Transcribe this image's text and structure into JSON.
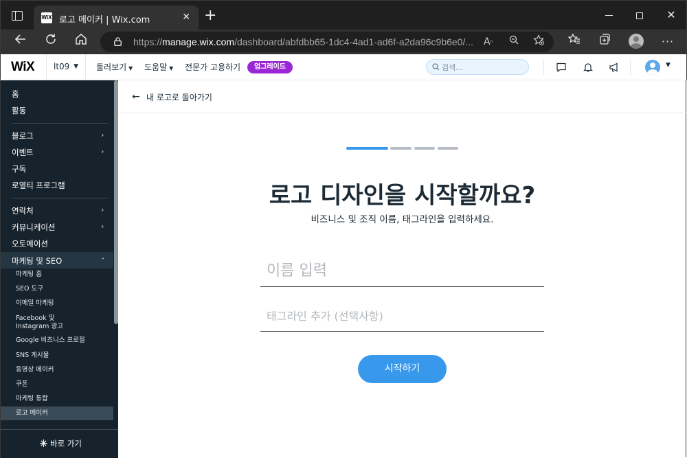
{
  "browser": {
    "tab_title": "로고 메이커 | Wix.com",
    "tab_favicon_text": "WiX",
    "url_prefix": "https://",
    "url_host": "manage.wix.com",
    "url_path": "/dashboard/abfdbb65-1dc4-4ad1-ad6f-a2da96c9b6e0/...",
    "icons": [
      "window-icon",
      "close-tab-icon",
      "new-tab-icon",
      "minimize-icon",
      "maximize-icon",
      "close-window-icon",
      "back-icon",
      "refresh-icon",
      "home-icon",
      "lock-icon",
      "read-aloud-icon",
      "zoom-icon",
      "add-favorite-icon",
      "favorites-icon",
      "collections-icon",
      "profile-icon",
      "more-icon"
    ]
  },
  "wix_header": {
    "logo": "WiX",
    "site_name": "lt09",
    "nav": [
      "둘러보기",
      "도움말",
      "전문가 고용하기"
    ],
    "upgrade_label": "업그레이드",
    "search_placeholder": "검색...",
    "upgrade_color": "#9a27d5"
  },
  "sidebar": {
    "items": [
      {
        "label": "홈"
      },
      {
        "label": "활동"
      },
      {
        "label": "블로그",
        "arrow": "›"
      },
      {
        "label": "이벤트",
        "arrow": "›"
      },
      {
        "label": "구독"
      },
      {
        "label": "로열티 프로그램"
      },
      {
        "label": "연락처",
        "arrow": "›"
      },
      {
        "label": "커뮤니케이션",
        "arrow": "›"
      },
      {
        "label": "오토메이션"
      },
      {
        "label": "마케팅 및 SEO",
        "arrow": "ˆ"
      }
    ],
    "sub_items": [
      "마케팅 홈",
      "SEO 도구",
      "이메일 마케팅",
      "Facebook 및",
      "Instagram 광고",
      "Google 비즈니스 프로필",
      "SNS 게시물",
      "동영상 메이커",
      "쿠폰",
      "마케팅 통합",
      "로고 메이커"
    ],
    "bottom_label": "바로 가기"
  },
  "main": {
    "back_label": "내 로고로 돌아가기",
    "heading": "로고 디자인을 시작할까요?",
    "subheading": "비즈니스 및 조직 이름, 태그라인을 입력하세요.",
    "name_placeholder": "이름 입력",
    "tagline_placeholder": "태그라인 추가 (선택사항)",
    "start_button": "시작하기",
    "progress": {
      "current_step": 1,
      "total_steps": 4
    },
    "accent_color": "#3899ec"
  }
}
